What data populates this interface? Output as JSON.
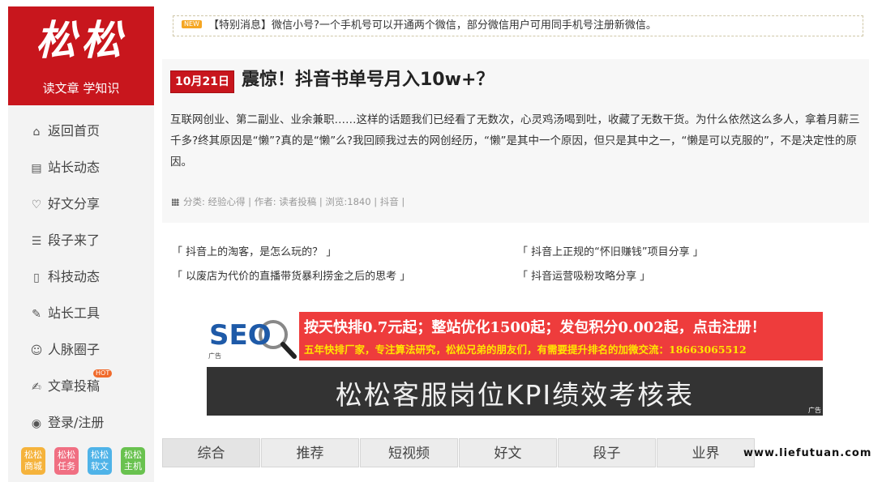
{
  "logo": {
    "mark": "松松",
    "subtitle": "读文章 学知识"
  },
  "nav": [
    {
      "icon": "home-icon",
      "glyph": "⌂",
      "label": "返回首页"
    },
    {
      "icon": "book-icon",
      "glyph": "▤",
      "label": "站长动态"
    },
    {
      "icon": "heart-icon",
      "glyph": "♡",
      "label": "好文分享"
    },
    {
      "icon": "list-icon",
      "glyph": "☰",
      "label": "段子来了"
    },
    {
      "icon": "file-icon",
      "glyph": "▯",
      "label": "科技动态"
    },
    {
      "icon": "wrench-icon",
      "glyph": "✎",
      "label": "站长工具"
    },
    {
      "icon": "user-icon",
      "glyph": "☺",
      "label": "人脉圈子"
    },
    {
      "icon": "edit-icon",
      "glyph": "✍",
      "label": "文章投稿",
      "badge": "HOT"
    },
    {
      "icon": "user-circle-icon",
      "glyph": "◉",
      "label": "登录/注册"
    }
  ],
  "quick_links": [
    {
      "label": "松松商城",
      "color": "#f5b33c"
    },
    {
      "label": "松松任务",
      "color": "#f06f82"
    },
    {
      "label": "松松软文",
      "color": "#4fb3e8"
    },
    {
      "label": "松松主机",
      "color": "#69c24f"
    }
  ],
  "notice": {
    "badge": "NEW",
    "text": "【特别消息】微信小号?一个手机号可以开通两个微信，部分微信用户可用同手机号注册新微信。"
  },
  "article": {
    "date": "10月21日",
    "title": "震惊！抖音书单号月入10w+？",
    "body": "互联网创业、第二副业、业余兼职……这样的话题我们已经看了无数次，心灵鸡汤喝到吐，收藏了无数干货。为什么依然这么多人，拿着月薪三千多?终其原因是“懒”?真的是“懒”么?我回顾我过去的网创经历，“懒”是其中一个原因，但只是其中之一，“懒是可以克服的”，不是决定性的原因。",
    "meta": "分类: 经验心得 | 作者: 读者投稿 | 浏览:1840 | 抖音 |"
  },
  "related": [
    "「 抖音上的淘客，是怎么玩的？ 」",
    "「 抖音上正规的“怀旧赚钱”项目分享 」",
    "「 以废店为代价的直播带货暴利捞金之后的思考 」",
    "「 抖音运营吸粉攻略分享 」"
  ],
  "ads": {
    "tag": "广告",
    "seo_logo": "SEO",
    "banner1_line1": "按天快排0.7元起；整站优化1500起；发包积分0.002起，点击注册！",
    "banner1_line2": "五年快排厂家，专注算法研究，松松兄弟的朋友们，有需要提升排名的加微交流：18663065512",
    "banner2_text": "松松客服岗位KPI绩效考核表"
  },
  "tabs": [
    "综合",
    "推荐",
    "短视频",
    "好文",
    "段子",
    "业界"
  ],
  "watermark": "www.liefutuan.com"
}
